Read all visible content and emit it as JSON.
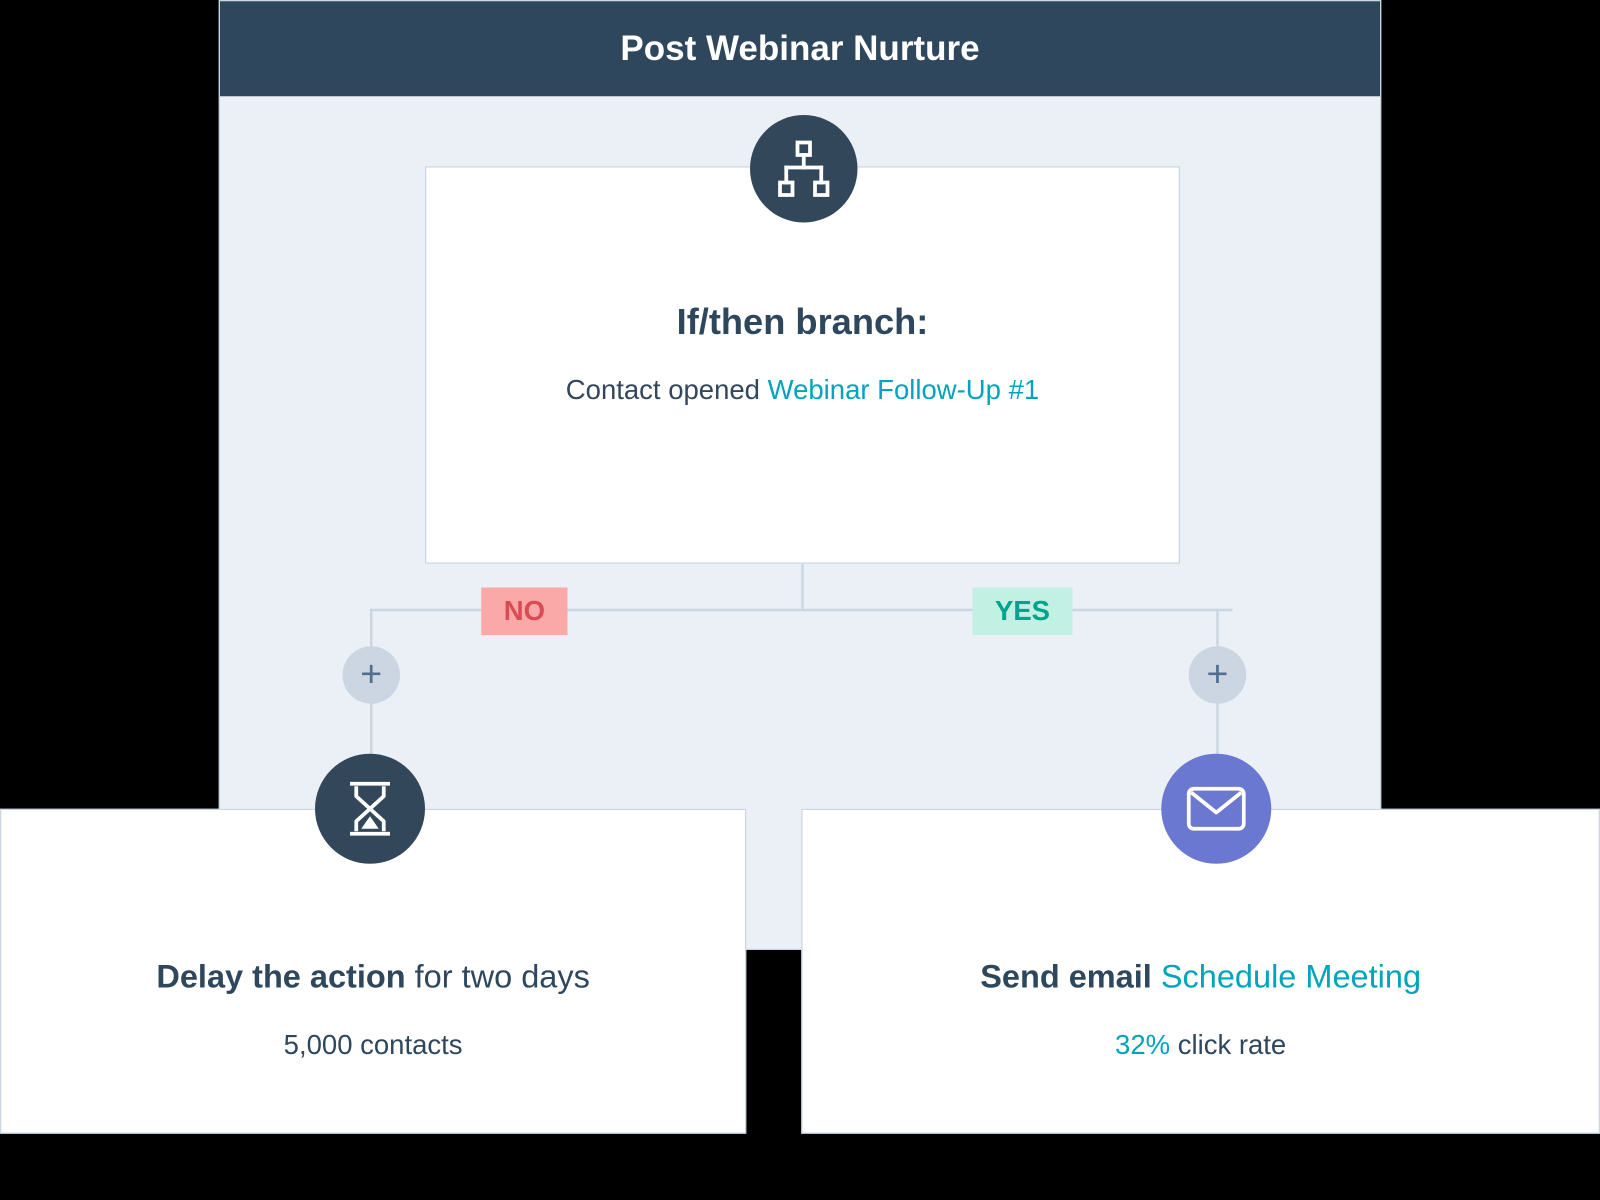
{
  "header": {
    "title": "Post Webinar Nurture"
  },
  "branch": {
    "title": "If/then branch:",
    "desc_prefix": "Contact opened ",
    "desc_link": "Webinar Follow-Up #1",
    "no_label": "NO",
    "yes_label": "YES"
  },
  "delay_card": {
    "title_bold": "Delay the action",
    "title_rest": " for two days",
    "sub": "5,000 contacts"
  },
  "email_card": {
    "title_bold": "Send email ",
    "title_link": "Schedule Meeting",
    "stat_value": "32%",
    "stat_rest": " click rate"
  },
  "icons": {
    "plus": "+"
  }
}
